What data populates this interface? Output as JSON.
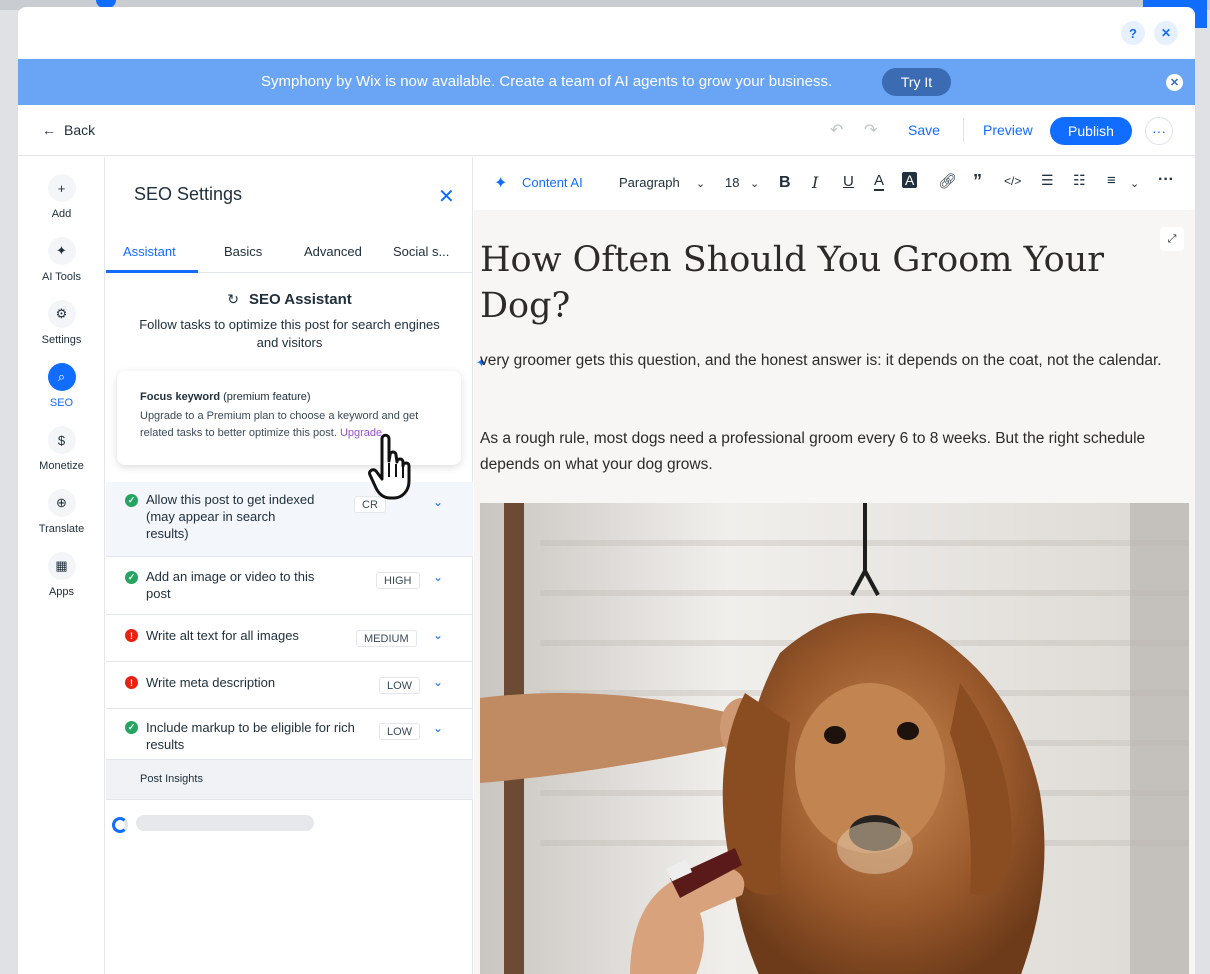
{
  "outer": {},
  "banner": {
    "text": "Symphony by Wix is now available. Create a team of AI agents to grow your business.",
    "cta": "Try It"
  },
  "window_controls": {
    "help_icon": "?",
    "close_icon": "✕"
  },
  "toolbar": {
    "back_label": "Back",
    "save_label": "Save",
    "preview_label": "Preview",
    "publish_label": "Publish",
    "more_label": "···"
  },
  "left_nav": [
    {
      "label": "Add",
      "icon": "+"
    },
    {
      "label": "AI Tools",
      "icon": "✦"
    },
    {
      "label": "Settings",
      "icon": "⚙"
    },
    {
      "label": "SEO",
      "icon": "⌕"
    },
    {
      "label": "Monetize",
      "icon": "$"
    },
    {
      "label": "Translate",
      "icon": "⊕"
    },
    {
      "label": "Apps",
      "icon": "▦"
    }
  ],
  "seo_panel": {
    "title": "SEO Settings",
    "tabs": [
      "Assistant",
      "Basics",
      "Advanced",
      "Social s..."
    ],
    "assistant_title": "SEO Assistant",
    "assistant_subtitle": "Follow tasks to optimize this post for search engines and visitors",
    "focus_card": {
      "title_bold": "Focus keyword",
      "title_rest": " (premium feature)",
      "body": "Upgrade to a Premium plan to choose a keyword and get related tasks to better optimize this post.",
      "link": "Upgrade"
    },
    "tasks": [
      {
        "label": "Allow this post to get indexed (may appear in search results)",
        "priority": "CR",
        "status": "ok"
      },
      {
        "label": "Add an image or video to this post",
        "priority": "HIGH",
        "status": "ok"
      },
      {
        "label": "Write alt text for all images",
        "priority": "MEDIUM",
        "status": "error"
      },
      {
        "label": "Write meta description",
        "priority": "LOW",
        "status": "error"
      },
      {
        "label": "Include markup to be eligible for rich results",
        "priority": "LOW",
        "status": "ok"
      }
    ],
    "insights_label": "Post Insights"
  },
  "editor": {
    "content_ai_label": "Content AI",
    "paragraph_label": "Paragraph",
    "font_size": "18",
    "title": "How Often Should You Groom Your Dog?",
    "paragraphs": [
      "very groomer gets this question, and the honest answer is: it depends on the coat, not the calendar.",
      "As a rough rule, most dogs need a professional groom every 6 to 8 weeks. But the right schedule depends on what your dog grows."
    ]
  },
  "colors": {
    "accent": "#116dff",
    "banner": "#6aa5f5",
    "ok": "#25a55f",
    "error": "#e62214",
    "upgrade_link": "#9a4fd0"
  }
}
